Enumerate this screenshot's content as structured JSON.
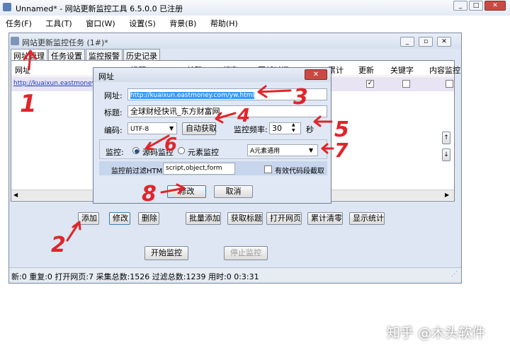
{
  "app": {
    "title": "Unnamed* - 网站更新监控工具 6.5.0.0 已注册"
  },
  "menu": [
    "任务(F)",
    "工具(T)",
    "窗口(W)",
    "设置(S)",
    "背景(B)",
    "帮助(H)"
  ],
  "inner_window": {
    "title": "网站更新监控任务 (1#)*"
  },
  "tabs": [
    {
      "label": "网址管理",
      "active": true
    },
    {
      "label": "任务设置",
      "active": false
    },
    {
      "label": "监控报警",
      "active": false
    },
    {
      "label": "历史记录",
      "active": false
    }
  ],
  "table": {
    "headers": [
      "网址",
      "标题",
      "编码",
      "频率",
      "更新时间",
      "累计",
      "更新",
      "关键字",
      "内容监控"
    ],
    "row": {
      "url": "http://kuaixun.eastmoney.com/yw.html",
      "update_checked": true,
      "keyword_checked": false,
      "content_monitor_checked": false
    }
  },
  "buttons": {
    "add": "添加",
    "edit": "修改",
    "delete": "删除",
    "batch_add": "批量添加",
    "fetch_title": "获取标题",
    "open_page": "打开网页",
    "clear_count": "累计清零",
    "show_stats": "显示统计",
    "start": "开始监控",
    "stop": "停止监控"
  },
  "dialog": {
    "title": "网址",
    "url_label": "网址:",
    "url_value": "http://kuaixun.eastmoney.com/yw.html",
    "title_label": "标题:",
    "title_value": "全球财经快讯_东方财富网",
    "encoding_label": "编码:",
    "encoding_value": "UTF-8",
    "auto_detect": "自动获取",
    "freq_label": "监控频率:",
    "freq_value": "30",
    "freq_unit": "秒",
    "monitor_label": "监控:",
    "mode_source": "源码监控",
    "mode_element": "元素监控",
    "mode_selected": "source",
    "element_option": "A元素通用",
    "filter_label": "监控前过滤HTML",
    "filter_value": "script,object,form",
    "valid_code_label": "有效代码段截取",
    "valid_code_checked": false,
    "ok": "修改",
    "cancel": "取消"
  },
  "status_text": "新:0 重复:0 打开网页:7 采集总数:1526 过滤总数:1239 用时:0 0:3:31",
  "annotations": [
    "1",
    "2",
    "3",
    "4",
    "5",
    "6",
    "7",
    "8"
  ],
  "watermark": "知乎 @木头软件",
  "colors": {
    "annotation_red": "#e0252b",
    "selection_blue": "#3399ff"
  }
}
